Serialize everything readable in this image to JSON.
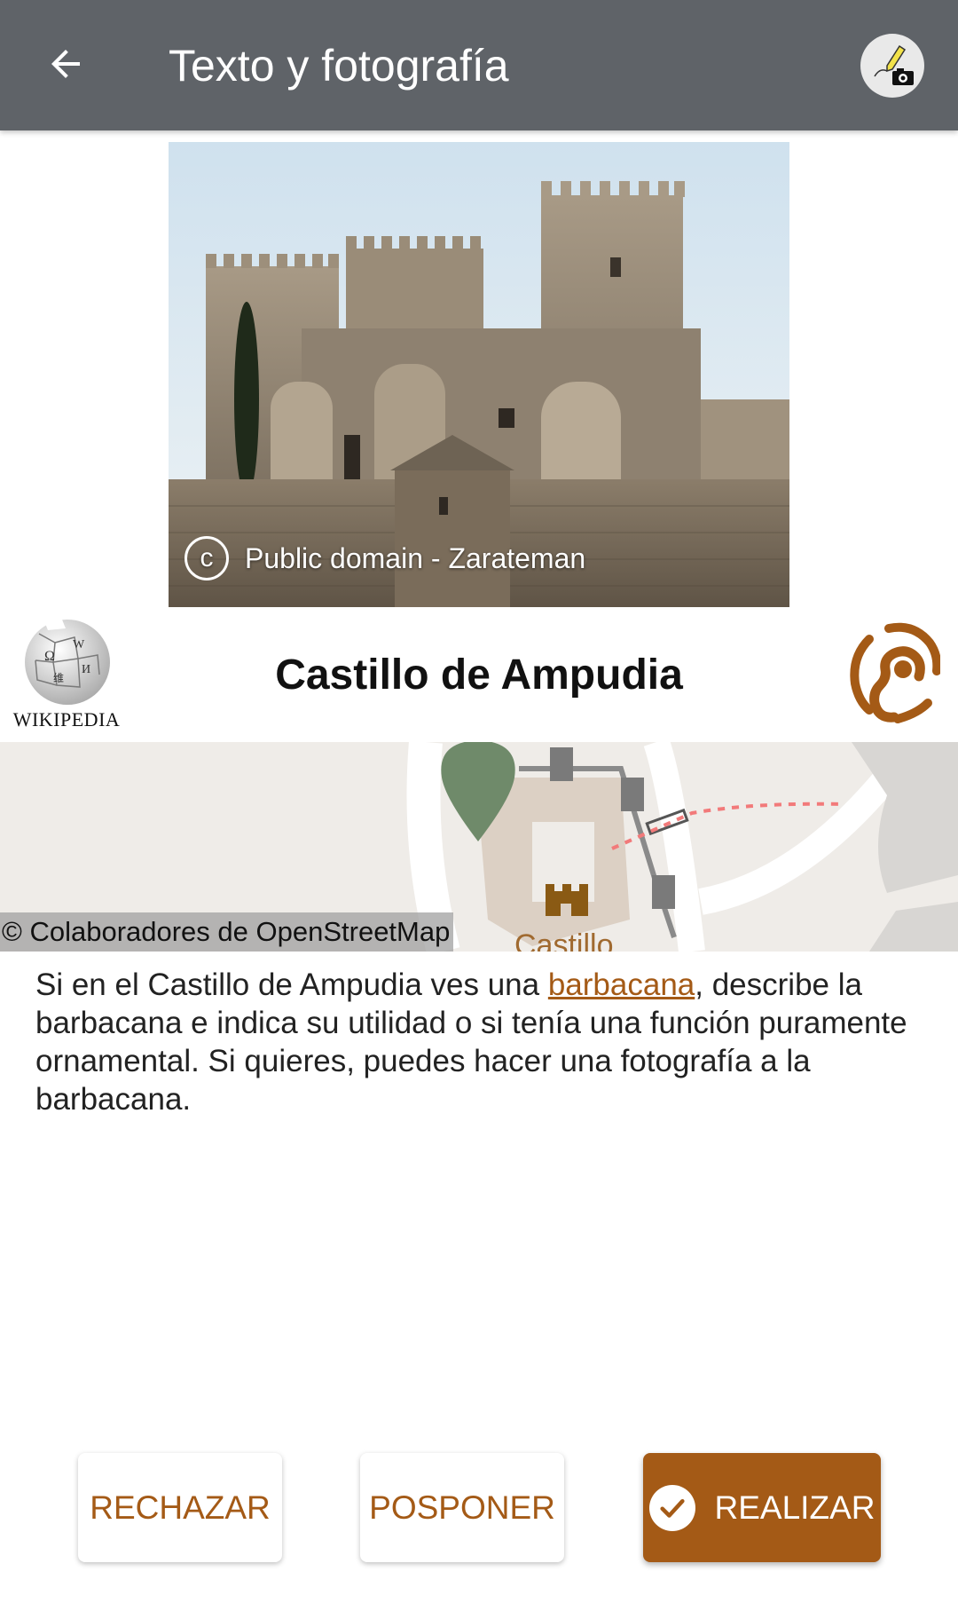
{
  "app_bar": {
    "title": "Texto y fotografía",
    "back_icon": "arrow-left-icon",
    "task_icon": "pencil-camera-icon"
  },
  "photo": {
    "credit": "Public domain - Zarateman",
    "license_icon": "copyright-icon"
  },
  "poi": {
    "title": "Castillo de Ampudia",
    "wikipedia_word": "WIKIPEDIA",
    "audio_icon": "ear-icon"
  },
  "map": {
    "attribution": "© Colaboradores de OpenStreetMap",
    "label": "Castillo"
  },
  "task": {
    "text_before": "Si en el Castillo de Ampudia ves una ",
    "link": "barbacana",
    "text_after": ", describe la barbacana e indica su utilidad o si tenía una función puramente ornamental. Si quieres, puedes hacer una fotografía a la barbacana."
  },
  "actions": {
    "reject": "RECHAZAR",
    "postpone": "POSPONER",
    "complete": "REALIZAR"
  },
  "colors": {
    "app_bar": "#5f6368",
    "accent": "#a45a16",
    "marker": "#6f8a6a"
  }
}
